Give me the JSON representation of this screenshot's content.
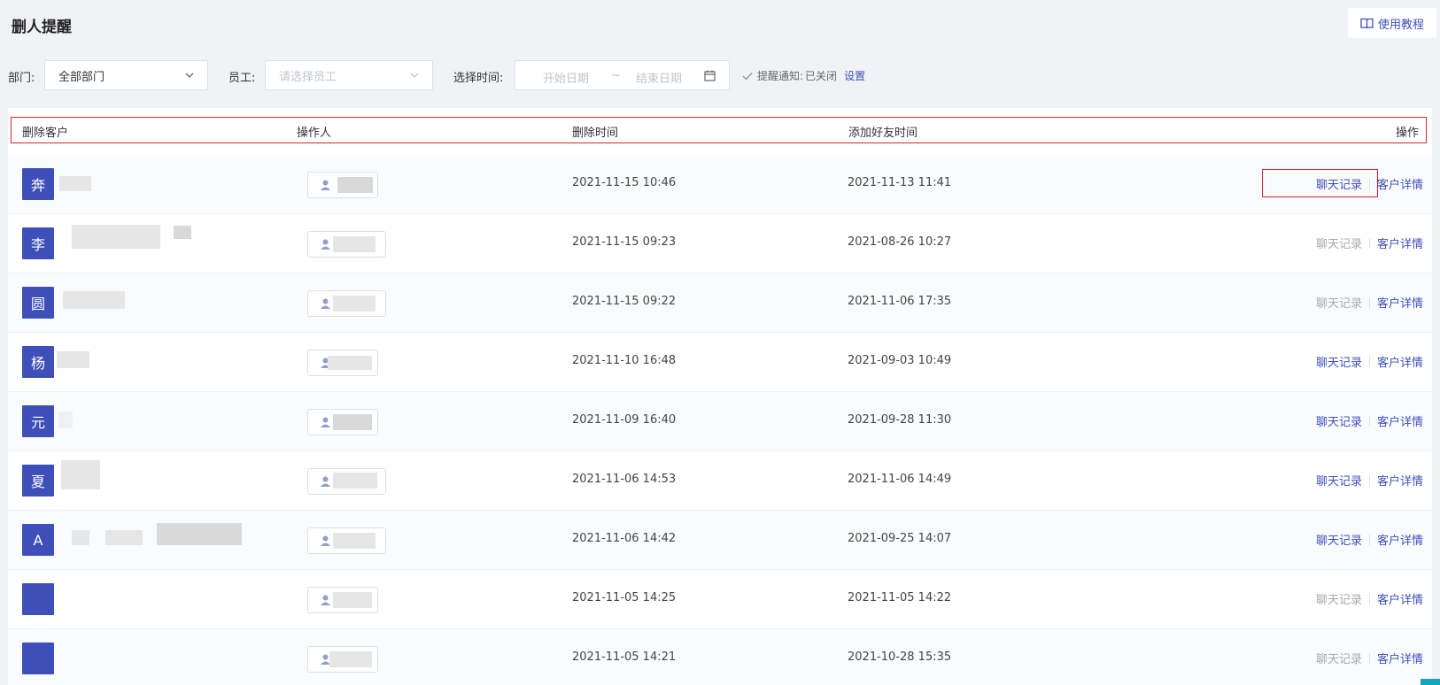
{
  "page": {
    "title": "删人提醒",
    "tutorial_label": "使用教程"
  },
  "filters": {
    "dept_label": "部门:",
    "dept_value": "全部部门",
    "staff_label": "员工:",
    "staff_placeholder": "请选择员工",
    "time_label": "选择时间:",
    "start_placeholder": "开始日期",
    "range_sep": "~",
    "end_placeholder": "结束日期",
    "notify_label": "提醒通知:",
    "notify_status": "已关闭",
    "notify_setting": "设置"
  },
  "table": {
    "columns": [
      "删除客户",
      "操作人",
      "删除时间",
      "添加好友时间",
      "操作"
    ],
    "chat_label": "聊天记录",
    "detail_label": "客户详情",
    "rows": [
      {
        "avatar": "奔",
        "deleted_at": "2021-11-15 10:46",
        "added_at": "2021-11-13 11:41",
        "chat_enabled": true
      },
      {
        "avatar": "李",
        "deleted_at": "2021-11-15 09:23",
        "added_at": "2021-08-26 10:27",
        "chat_enabled": false
      },
      {
        "avatar": "圆",
        "deleted_at": "2021-11-15 09:22",
        "added_at": "2021-11-06 17:35",
        "chat_enabled": false
      },
      {
        "avatar": "杨",
        "deleted_at": "2021-11-10 16:48",
        "added_at": "2021-09-03 10:49",
        "chat_enabled": true
      },
      {
        "avatar": "元",
        "deleted_at": "2021-11-09 16:40",
        "added_at": "2021-09-28 11:30",
        "chat_enabled": true
      },
      {
        "avatar": "夏",
        "deleted_at": "2021-11-06 14:53",
        "added_at": "2021-11-06 14:49",
        "chat_enabled": true
      },
      {
        "avatar": "A",
        "deleted_at": "2021-11-06 14:42",
        "added_at": "2021-09-25 14:07",
        "chat_enabled": true
      },
      {
        "avatar": "",
        "deleted_at": "2021-11-05 14:25",
        "added_at": "2021-11-05 14:22",
        "chat_enabled": false
      },
      {
        "avatar": "",
        "deleted_at": "2021-11-05 14:21",
        "added_at": "2021-10-28 15:35",
        "chat_enabled": false
      }
    ]
  },
  "colors": {
    "accent": "#3e4fba",
    "highlight_border": "#e0232c",
    "muted_link": "#a8a8a8"
  }
}
